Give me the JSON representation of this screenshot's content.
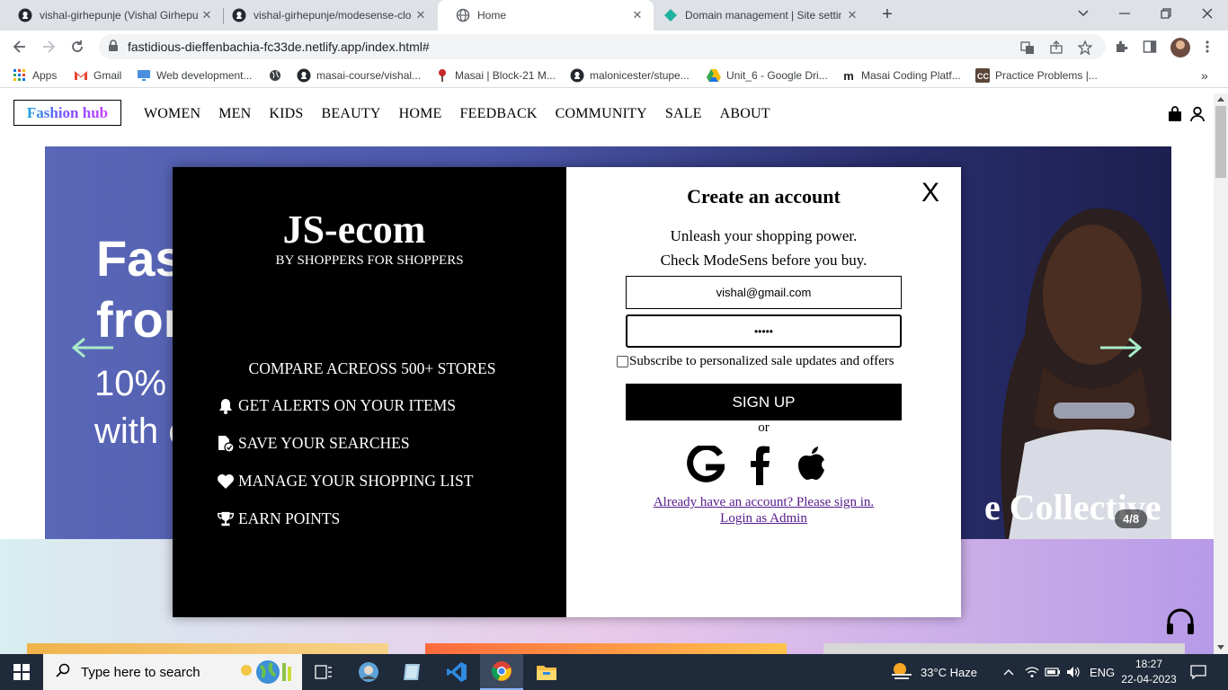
{
  "browser": {
    "tabs": [
      {
        "title": "vishal-girhepunje (Vishal Girhepunje)",
        "icon": "github-icon"
      },
      {
        "title": "vishal-girhepunje/modesense-clone",
        "icon": "github-icon"
      },
      {
        "title": "Home",
        "icon": "globe-icon",
        "active": true
      },
      {
        "title": "Domain management | Site settings",
        "icon": "netlify-icon"
      }
    ],
    "url": "fastidious-dieffenbachia-fc33de.netlify.app/index.html#",
    "bookmarks": [
      {
        "label": "Apps",
        "icon": "apps-grid-icon"
      },
      {
        "label": "Gmail",
        "icon": "gmail-icon"
      },
      {
        "label": "Web development...",
        "icon": "monitor-icon"
      },
      {
        "label": "",
        "icon": "globe-icon"
      },
      {
        "label": "masai-course/vishal...",
        "icon": "github-icon"
      },
      {
        "label": "Masai | Block-21 M...",
        "icon": "masai-icon"
      },
      {
        "label": "malonicester/stupe...",
        "icon": "github-icon"
      },
      {
        "label": "Unit_6 - Google Dri...",
        "icon": "google-drive-icon"
      },
      {
        "label": "Masai Coding Platf...",
        "icon": "masai-m-icon"
      },
      {
        "label": "Practice Problems |...",
        "icon": "cc-icon"
      }
    ]
  },
  "site": {
    "logo": "Fashion hub",
    "nav": [
      "WOMEN",
      "MEN",
      "KIDS",
      "BEAUTY",
      "HOME",
      "FEEDBACK",
      "COMMUNITY",
      "SALE",
      "ABOUT"
    ],
    "hero": {
      "line1": "Fas",
      "line2": "fron",
      "line3": "10%",
      "line4": "with c",
      "collective": "e Collective",
      "page_indicator": "4/8"
    }
  },
  "modal": {
    "brand": "JS-ecom",
    "tagline": "BY SHOPPERS FOR SHOPPERS",
    "features": [
      {
        "text": "COMPARE ACREOSS 500+ STORES",
        "icon": ""
      },
      {
        "text": "GET ALERTS ON YOUR ITEMS",
        "icon": "bell-icon"
      },
      {
        "text": "SAVE YOUR SEARCHES",
        "icon": "file-check-icon"
      },
      {
        "text": "MANAGE YOUR SHOPPING LIST",
        "icon": "heart-icon"
      },
      {
        "text": "EARN POINTS",
        "icon": "trophy-icon"
      }
    ],
    "title": "Create an account",
    "close": "X",
    "subtitle1": "Unleash your shopping power.",
    "subtitle2": "Check ModeSens before you buy.",
    "email_value": "vishal@gmail.com",
    "password_value": "•••••",
    "subscribe_label": "Subscribe to personalized sale updates and offers",
    "signup_label": "SIGN UP",
    "or_text": "or",
    "signin_link": "Already have an account? Please sign in.",
    "admin_link": "Login as Admin"
  },
  "taskbar": {
    "search_placeholder": "Type here to search",
    "weather": "33°C  Haze",
    "language": "ENG",
    "time": "18:27",
    "date": "22-04-2023"
  }
}
